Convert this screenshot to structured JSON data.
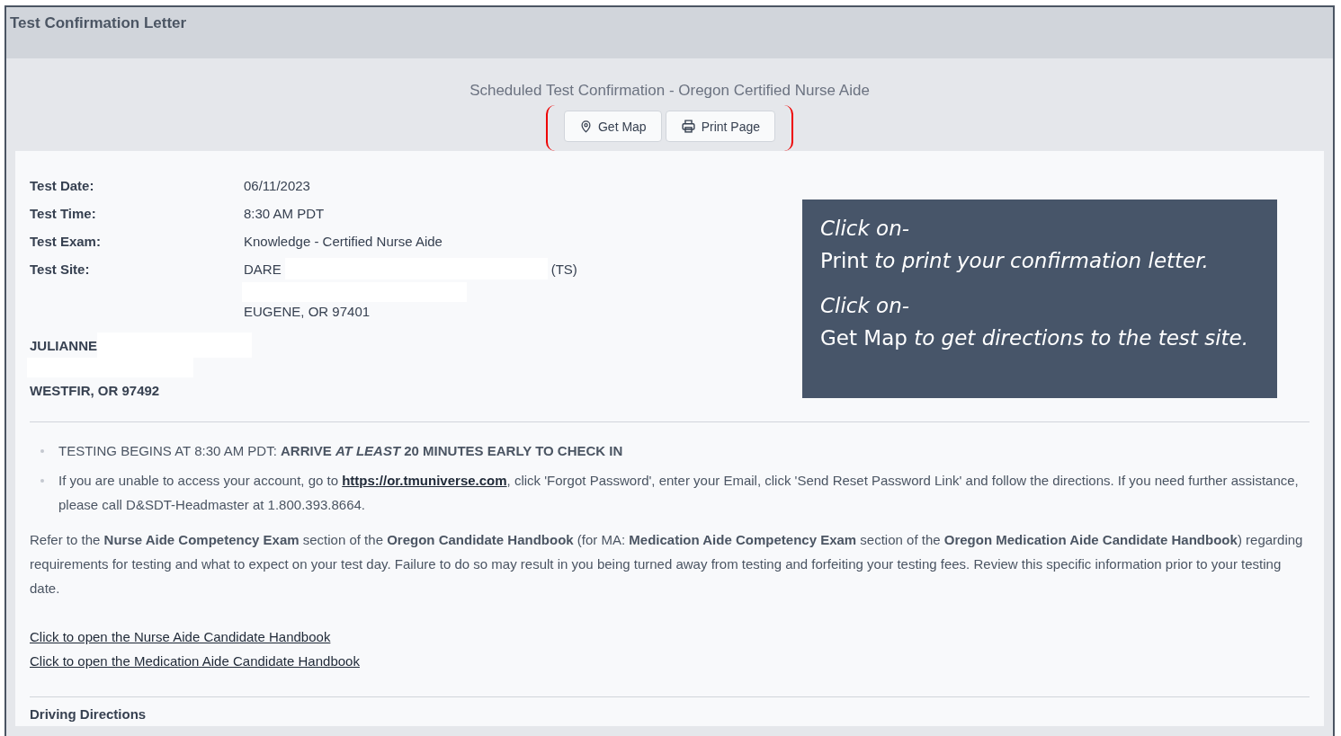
{
  "window": {
    "title": "Test Confirmation Letter"
  },
  "heading": "Scheduled Test Confirmation - Oregon Certified Nurse Aide",
  "buttons": [
    {
      "kind": "map",
      "label": "Get Map"
    },
    {
      "kind": "print",
      "label": "Print Page"
    }
  ],
  "details": [
    {
      "label": "Test Date:",
      "value": "06/11/2023"
    },
    {
      "label": "Test Time:",
      "value": "8:30 AM PDT"
    },
    {
      "label": "Test Exam:",
      "value": "Knowledge - Certified Nurse Aide"
    }
  ],
  "site": {
    "label": "Test Site:",
    "name": "DARE",
    "code": "(TS)",
    "city": "EUGENE, OR 97401"
  },
  "candidate": {
    "first_name": "JULIANNE",
    "city": "WESTFIR, OR 97492"
  },
  "callout": [
    [
      "Click on-",
      "**Print** to print your confirmation letter."
    ],
    [
      "Click on-",
      "**Get Map** to get directions to the test site."
    ]
  ],
  "notices": [
    {
      "kind": "text",
      "text": "TESTING BEGINS AT 8:30 AM PDT:  **ARRIVE *AT LEAST* 20 MINUTES EARLY TO CHECK IN**"
    },
    {
      "kind": "link",
      "before": "If you are unable to access your account, go to",
      "link": "https://or.tmuniverse.com",
      "after": ", click 'Forgot Password', enter your Email, click 'Send Reset Password Link' and follow the directions.  If you need further assistance, please call D&SDT-Headmaster at 1.800.393.8664."
    }
  ],
  "paragraph": "Refer to the **Nurse Aide Competency Exam** section of the **Oregon Candidate Handbook** (for MA: **Medication Aide Competency Exam** section of the **Oregon Medication Aide Candidate Handbook**)  regarding requirements for testing and what to expect on your test day.  Failure to do so may result in you being turned away from testing and forfeiting your testing fees.  Review this specific information prior to your testing date.",
  "links": [
    "Click to open the Nurse Aide Candidate Handbook",
    "Click to open the Medication Aide Candidate Handbook"
  ],
  "section_heading": "Driving Directions"
}
